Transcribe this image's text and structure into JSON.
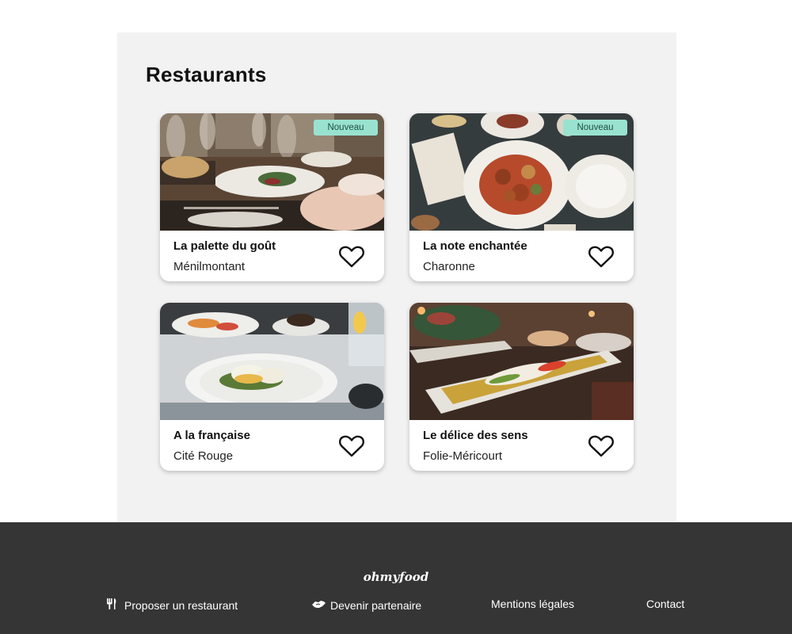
{
  "page": {
    "title": "Restaurants"
  },
  "restaurants": [
    {
      "name": "La palette du goût",
      "location": "Ménilmontant",
      "badge": "Nouveau",
      "image": "plated-dish-restaurant-table-photo"
    },
    {
      "name": "La note enchantée",
      "location": "Charonne",
      "badge": "Nouveau",
      "image": "meatballs-plate-topdown-photo"
    },
    {
      "name": "A la française",
      "location": "Cité Rouge",
      "badge": "",
      "image": "poached-eggs-plate-photo"
    },
    {
      "name": "Le délice des sens",
      "location": "Folie-Méricourt",
      "badge": "",
      "image": "fish-long-plate-photo"
    }
  ],
  "footer": {
    "logo": "ohmyfood",
    "links": [
      {
        "label": "Proposer un restaurant",
        "icon": "utensils-icon"
      },
      {
        "label": "Devenir partenaire",
        "icon": "handshake-icon"
      },
      {
        "label": "Mentions légales"
      },
      {
        "label": "Contact"
      }
    ]
  },
  "colors": {
    "badge_bg": "#99e2d0",
    "footer_bg": "#353535",
    "main_bg": "#f2f2f2"
  }
}
